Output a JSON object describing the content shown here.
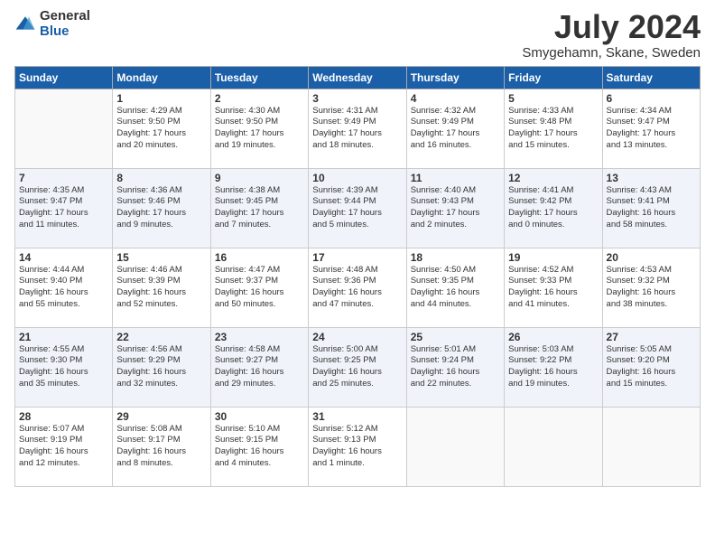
{
  "logo": {
    "general": "General",
    "blue": "Blue"
  },
  "title": "July 2024",
  "location": "Smygehamn, Skane, Sweden",
  "weekdays": [
    "Sunday",
    "Monday",
    "Tuesday",
    "Wednesday",
    "Thursday",
    "Friday",
    "Saturday"
  ],
  "weeks": [
    [
      {
        "day": "",
        "info": ""
      },
      {
        "day": "1",
        "info": "Sunrise: 4:29 AM\nSunset: 9:50 PM\nDaylight: 17 hours\nand 20 minutes."
      },
      {
        "day": "2",
        "info": "Sunrise: 4:30 AM\nSunset: 9:50 PM\nDaylight: 17 hours\nand 19 minutes."
      },
      {
        "day": "3",
        "info": "Sunrise: 4:31 AM\nSunset: 9:49 PM\nDaylight: 17 hours\nand 18 minutes."
      },
      {
        "day": "4",
        "info": "Sunrise: 4:32 AM\nSunset: 9:49 PM\nDaylight: 17 hours\nand 16 minutes."
      },
      {
        "day": "5",
        "info": "Sunrise: 4:33 AM\nSunset: 9:48 PM\nDaylight: 17 hours\nand 15 minutes."
      },
      {
        "day": "6",
        "info": "Sunrise: 4:34 AM\nSunset: 9:47 PM\nDaylight: 17 hours\nand 13 minutes."
      }
    ],
    [
      {
        "day": "7",
        "info": "Sunrise: 4:35 AM\nSunset: 9:47 PM\nDaylight: 17 hours\nand 11 minutes."
      },
      {
        "day": "8",
        "info": "Sunrise: 4:36 AM\nSunset: 9:46 PM\nDaylight: 17 hours\nand 9 minutes."
      },
      {
        "day": "9",
        "info": "Sunrise: 4:38 AM\nSunset: 9:45 PM\nDaylight: 17 hours\nand 7 minutes."
      },
      {
        "day": "10",
        "info": "Sunrise: 4:39 AM\nSunset: 9:44 PM\nDaylight: 17 hours\nand 5 minutes."
      },
      {
        "day": "11",
        "info": "Sunrise: 4:40 AM\nSunset: 9:43 PM\nDaylight: 17 hours\nand 2 minutes."
      },
      {
        "day": "12",
        "info": "Sunrise: 4:41 AM\nSunset: 9:42 PM\nDaylight: 17 hours\nand 0 minutes."
      },
      {
        "day": "13",
        "info": "Sunrise: 4:43 AM\nSunset: 9:41 PM\nDaylight: 16 hours\nand 58 minutes."
      }
    ],
    [
      {
        "day": "14",
        "info": "Sunrise: 4:44 AM\nSunset: 9:40 PM\nDaylight: 16 hours\nand 55 minutes."
      },
      {
        "day": "15",
        "info": "Sunrise: 4:46 AM\nSunset: 9:39 PM\nDaylight: 16 hours\nand 52 minutes."
      },
      {
        "day": "16",
        "info": "Sunrise: 4:47 AM\nSunset: 9:37 PM\nDaylight: 16 hours\nand 50 minutes."
      },
      {
        "day": "17",
        "info": "Sunrise: 4:48 AM\nSunset: 9:36 PM\nDaylight: 16 hours\nand 47 minutes."
      },
      {
        "day": "18",
        "info": "Sunrise: 4:50 AM\nSunset: 9:35 PM\nDaylight: 16 hours\nand 44 minutes."
      },
      {
        "day": "19",
        "info": "Sunrise: 4:52 AM\nSunset: 9:33 PM\nDaylight: 16 hours\nand 41 minutes."
      },
      {
        "day": "20",
        "info": "Sunrise: 4:53 AM\nSunset: 9:32 PM\nDaylight: 16 hours\nand 38 minutes."
      }
    ],
    [
      {
        "day": "21",
        "info": "Sunrise: 4:55 AM\nSunset: 9:30 PM\nDaylight: 16 hours\nand 35 minutes."
      },
      {
        "day": "22",
        "info": "Sunrise: 4:56 AM\nSunset: 9:29 PM\nDaylight: 16 hours\nand 32 minutes."
      },
      {
        "day": "23",
        "info": "Sunrise: 4:58 AM\nSunset: 9:27 PM\nDaylight: 16 hours\nand 29 minutes."
      },
      {
        "day": "24",
        "info": "Sunrise: 5:00 AM\nSunset: 9:25 PM\nDaylight: 16 hours\nand 25 minutes."
      },
      {
        "day": "25",
        "info": "Sunrise: 5:01 AM\nSunset: 9:24 PM\nDaylight: 16 hours\nand 22 minutes."
      },
      {
        "day": "26",
        "info": "Sunrise: 5:03 AM\nSunset: 9:22 PM\nDaylight: 16 hours\nand 19 minutes."
      },
      {
        "day": "27",
        "info": "Sunrise: 5:05 AM\nSunset: 9:20 PM\nDaylight: 16 hours\nand 15 minutes."
      }
    ],
    [
      {
        "day": "28",
        "info": "Sunrise: 5:07 AM\nSunset: 9:19 PM\nDaylight: 16 hours\nand 12 minutes."
      },
      {
        "day": "29",
        "info": "Sunrise: 5:08 AM\nSunset: 9:17 PM\nDaylight: 16 hours\nand 8 minutes."
      },
      {
        "day": "30",
        "info": "Sunrise: 5:10 AM\nSunset: 9:15 PM\nDaylight: 16 hours\nand 4 minutes."
      },
      {
        "day": "31",
        "info": "Sunrise: 5:12 AM\nSunset: 9:13 PM\nDaylight: 16 hours\nand 1 minute."
      },
      {
        "day": "",
        "info": ""
      },
      {
        "day": "",
        "info": ""
      },
      {
        "day": "",
        "info": ""
      }
    ]
  ]
}
